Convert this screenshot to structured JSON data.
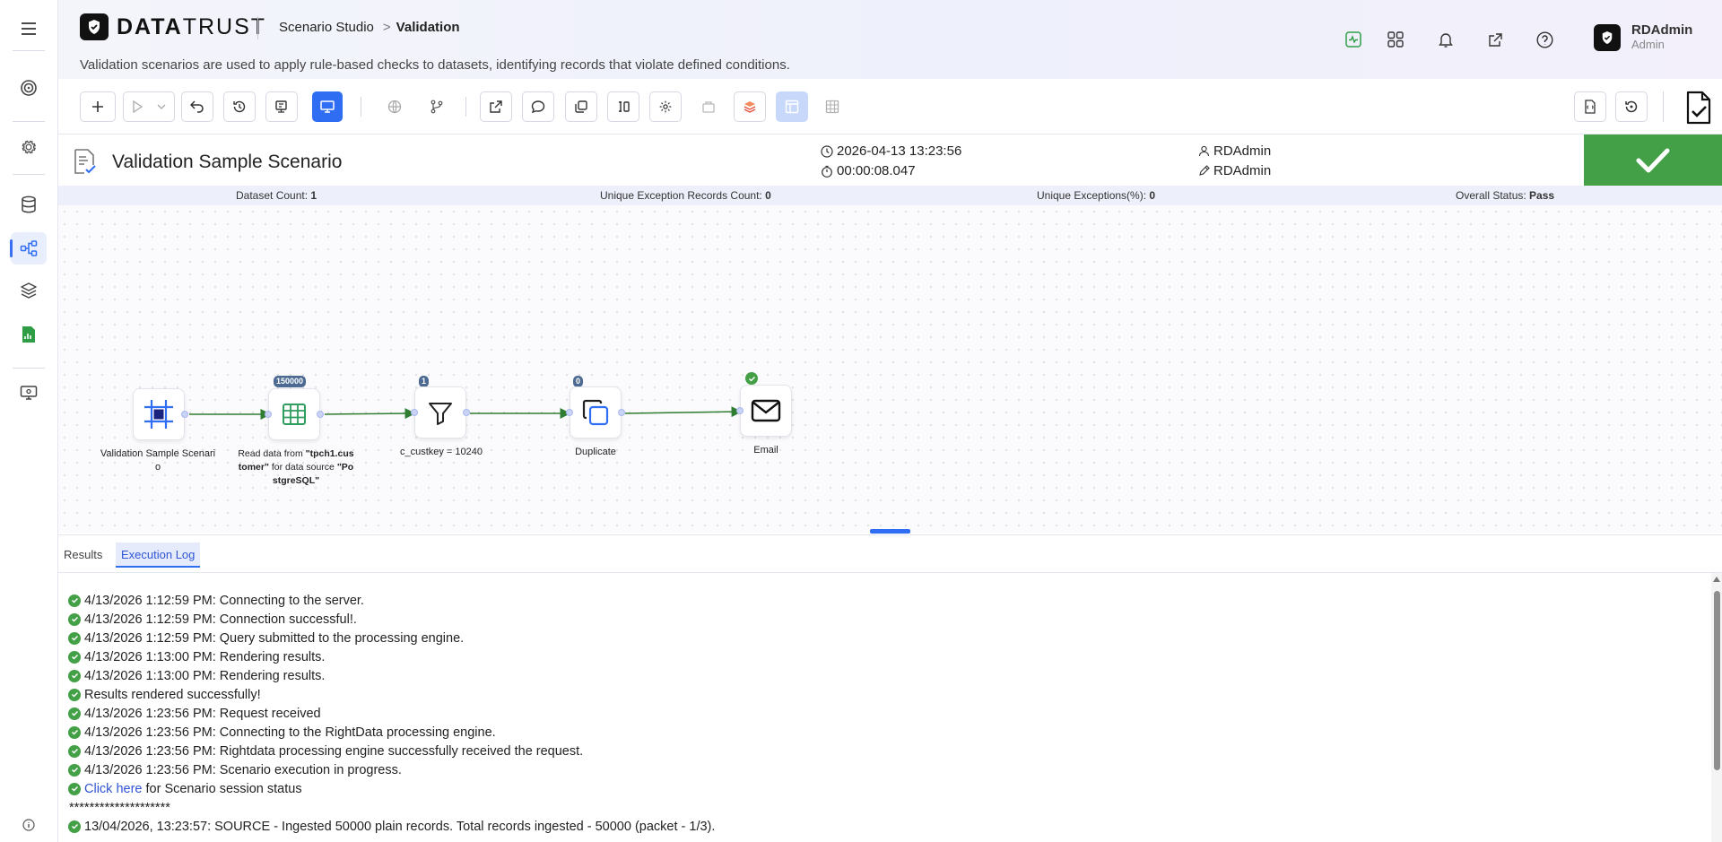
{
  "header": {
    "logo_text_bold": "DATA",
    "logo_text_rest": "TRUST",
    "breadcrumb_root": "Scenario Studio",
    "breadcrumb_separator": ">",
    "breadcrumb_current": "Validation",
    "subtitle": "Validation scenarios are used to apply rule-based checks to datasets, identifying records that violate defined conditions.",
    "icons": [
      "activity-icon",
      "apps-grid-icon",
      "bell-icon",
      "external-link-icon",
      "help-icon"
    ],
    "user": {
      "name": "RDAdmin",
      "role": "Admin"
    }
  },
  "sidebar": {
    "items": [
      "menu-icon",
      "target-icon",
      "settings-icon",
      "database-icon",
      "workflow-icon",
      "layers-icon",
      "report-icon",
      "monitor-settings-icon",
      "info-icon"
    ],
    "active": "workflow-icon"
  },
  "scenario": {
    "title": "Validation Sample Scenario",
    "timestamp": "2026-04-13 13:23:56",
    "duration": "00:00:08.047",
    "created_by": "RDAdmin",
    "modified_by": "RDAdmin",
    "status_color": "#43a047"
  },
  "stats": {
    "dataset_count_label": "Dataset Count:",
    "dataset_count": "1",
    "unique_exception_records_label": "Unique Exception Records Count:",
    "unique_exception_records": "0",
    "unique_exceptions_pct_label": "Unique Exceptions(%):",
    "unique_exceptions_pct": "0",
    "overall_status_label": "Overall Status:",
    "overall_status": "Pass"
  },
  "flow": {
    "nodes": [
      {
        "label": "Validation Sample Scenari o",
        "badge": ""
      },
      {
        "label_pre": "Read data from ",
        "label_b1": "\"tpch1.cus tomer\"",
        "label_mid": " for data source ",
        "label_b2": "\"Po stgreSQL\"",
        "badge": "150000"
      },
      {
        "label": "c_custkey = 10240",
        "badge": "1"
      },
      {
        "label": "Duplicate",
        "badge": "0"
      },
      {
        "label": "Email",
        "badge": ""
      }
    ]
  },
  "bottom": {
    "tabs": [
      "Results",
      "Execution Log"
    ],
    "active_tab": "Execution Log",
    "log": [
      "4/13/2026 1:12:59 PM: Connecting to the server.",
      "4/13/2026 1:12:59 PM: Connection successful!.",
      "4/13/2026 1:12:59 PM: Query submitted to the processing engine.",
      "4/13/2026 1:13:00 PM: Rendering results.",
      "4/13/2026 1:13:00 PM: Rendering results.",
      "Results rendered successfully!",
      "4/13/2026 1:23:56 PM: Request received",
      "4/13/2026 1:23:56 PM: Connecting to the RightData processing engine.",
      "4/13/2026 1:23:56 PM: Rightdata processing engine successfully received the request.",
      "4/13/2026 1:23:56 PM: Scenario execution in progress."
    ],
    "link_text": "Click here",
    "link_suffix": " for Scenario session status",
    "separator": "********************",
    "log_after": [
      "13/04/2026, 13:23:57: SOURCE - Ingested 50000 plain records. Total records ingested - 50000 (packet - 1/3)."
    ]
  }
}
